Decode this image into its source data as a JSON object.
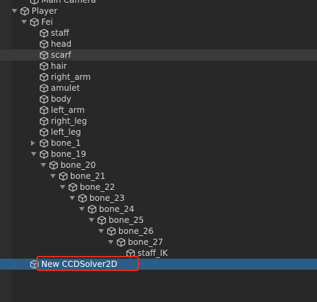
{
  "hierarchy": {
    "items": [
      {
        "label": "Main Camera",
        "depth": 2,
        "arrow": "none"
      },
      {
        "label": "Player",
        "depth": 1,
        "arrow": "down"
      },
      {
        "label": "Fei",
        "depth": 2,
        "arrow": "down"
      },
      {
        "label": "staff",
        "depth": 3,
        "arrow": "none"
      },
      {
        "label": "head",
        "depth": 3,
        "arrow": "none"
      },
      {
        "label": "scarf",
        "depth": 3,
        "arrow": "none",
        "state": "hover"
      },
      {
        "label": "hair",
        "depth": 3,
        "arrow": "none"
      },
      {
        "label": "right_arm",
        "depth": 3,
        "arrow": "none"
      },
      {
        "label": "amulet",
        "depth": 3,
        "arrow": "none"
      },
      {
        "label": "body",
        "depth": 3,
        "arrow": "none"
      },
      {
        "label": "left_arm",
        "depth": 3,
        "arrow": "none"
      },
      {
        "label": "right_leg",
        "depth": 3,
        "arrow": "none"
      },
      {
        "label": "left_leg",
        "depth": 3,
        "arrow": "none"
      },
      {
        "label": "bone_1",
        "depth": 3,
        "arrow": "right"
      },
      {
        "label": "bone_19",
        "depth": 3,
        "arrow": "down"
      },
      {
        "label": "bone_20",
        "depth": 4,
        "arrow": "down"
      },
      {
        "label": "bone_21",
        "depth": 5,
        "arrow": "down"
      },
      {
        "label": "bone_22",
        "depth": 6,
        "arrow": "down"
      },
      {
        "label": "bone_23",
        "depth": 7,
        "arrow": "down"
      },
      {
        "label": "bone_24",
        "depth": 8,
        "arrow": "down"
      },
      {
        "label": "bone_25",
        "depth": 9,
        "arrow": "down"
      },
      {
        "label": "bone_26",
        "depth": 10,
        "arrow": "down"
      },
      {
        "label": "bone_27",
        "depth": 11,
        "arrow": "down"
      },
      {
        "label": "staff_IK",
        "depth": 12,
        "arrow": "none"
      },
      {
        "label": "New CCDSolver2D",
        "depth": 2,
        "arrow": "none",
        "state": "selected"
      }
    ]
  },
  "icons": {
    "item": "gameobject-cube-icon",
    "gutter": "scene-pick-icon"
  },
  "colors": {
    "selected": "#2c5d87",
    "highlight_border": "#e0301e",
    "hover": "#3a3a3a"
  }
}
